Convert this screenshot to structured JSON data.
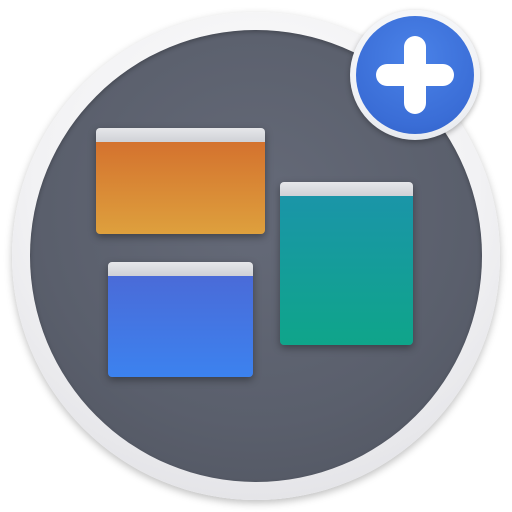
{
  "icon": {
    "name": "window-manager-add-app-icon",
    "colors": {
      "disc": "#5a5f6c",
      "ring": "#f2f2f4",
      "window_titlebar": "#dcdde1",
      "window_orange": "#d98a36",
      "window_teal": "#139d9b",
      "window_blue": "#4276e3",
      "plus_badge": "#3a6dd6",
      "plus_sign": "#ffffff"
    },
    "elements": [
      "window-orange",
      "window-teal",
      "window-blue",
      "plus-icon"
    ]
  }
}
